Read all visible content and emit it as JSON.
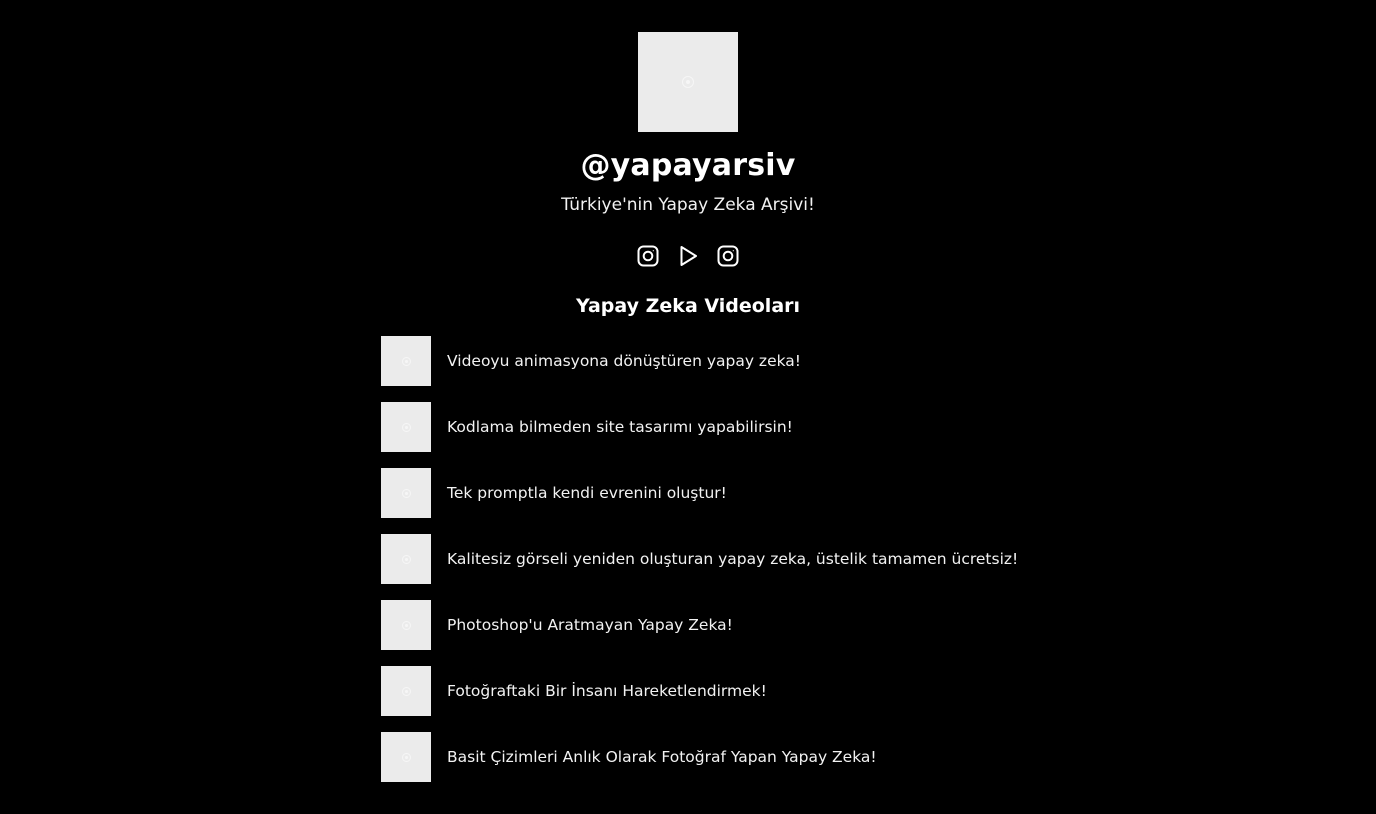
{
  "profile": {
    "avatar_alt": "profile image",
    "handle": "@yapayarsiv",
    "tagline": "Türkiye'nin Yapay Zeka Arşivi!"
  },
  "socials": [
    {
      "icon": "instagram-icon"
    },
    {
      "icon": "youtube-play-icon"
    },
    {
      "icon": "instagram-icon"
    }
  ],
  "section": {
    "title": "Yapay Zeka Videoları"
  },
  "videos": [
    {
      "title": "Videoyu animasyona dönüştüren yapay zeka!"
    },
    {
      "title": "Kodlama bilmeden site tasarımı yapabilirsin!"
    },
    {
      "title": "Tek promptla kendi evrenini oluştur!"
    },
    {
      "title": "Kalitesiz görseli yeniden oluşturan yapay zeka, üstelik tamamen ücretsiz!"
    },
    {
      "title": "Photoshop'u Aratmayan Yapay Zeka!"
    },
    {
      "title": "Fotoğraftaki Bir İnsanı Hareketlendirmek!"
    },
    {
      "title": "Basit Çizimleri Anlık Olarak Fotoğraf Yapan Yapay Zeka!"
    }
  ],
  "colors": {
    "background": "#000000",
    "text": "#ffffff",
    "placeholder": "#ebebeb"
  }
}
